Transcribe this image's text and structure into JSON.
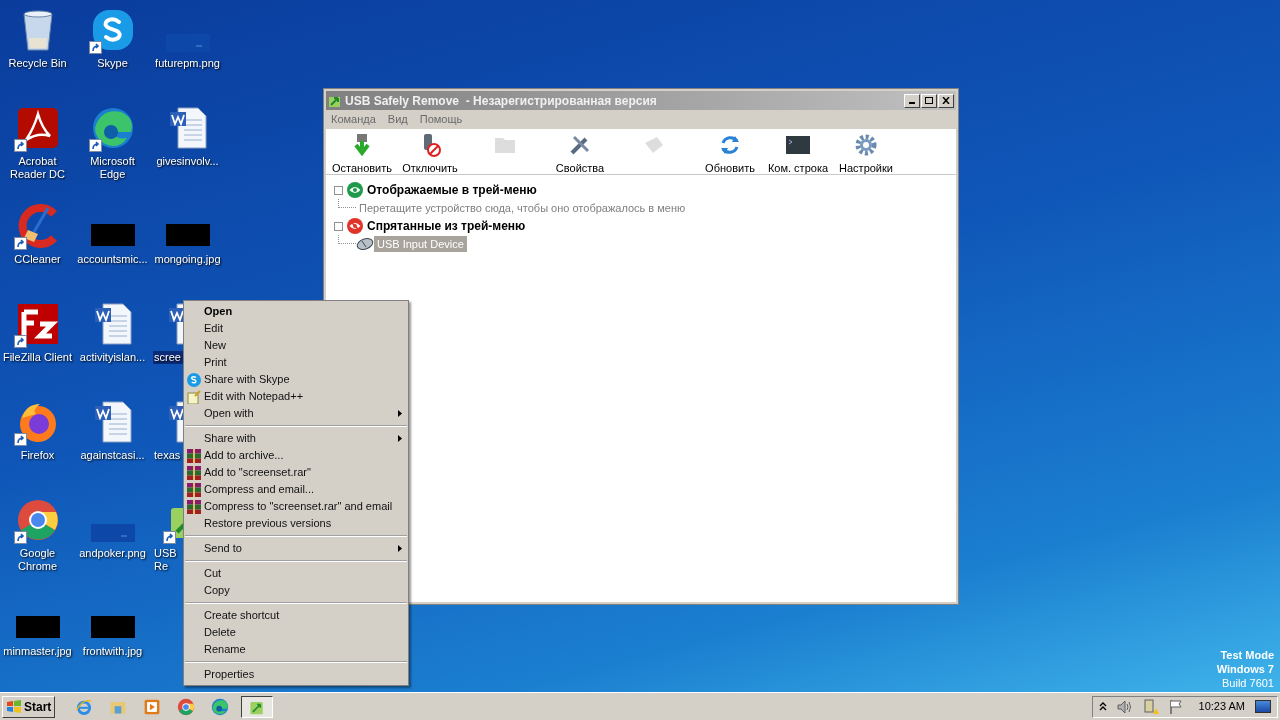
{
  "desktop": {
    "icons": [
      {
        "label": "Recycle Bin",
        "kind": "recycle",
        "shortcut": false,
        "selected": false,
        "covered": false
      },
      {
        "label": "Skype",
        "kind": "skype",
        "shortcut": true,
        "selected": false,
        "covered": false
      },
      {
        "label": "futurepm.png",
        "kind": "thumbblue",
        "shortcut": false,
        "selected": false,
        "covered": false
      },
      {
        "label": "Acrobat Reader DC",
        "kind": "pdf",
        "shortcut": true,
        "selected": false,
        "covered": false
      },
      {
        "label": "Microsoft Edge",
        "kind": "edge",
        "shortcut": true,
        "selected": false,
        "covered": false
      },
      {
        "label": "givesinvolv...",
        "kind": "word",
        "shortcut": false,
        "selected": false,
        "covered": false
      },
      {
        "label": "CCleaner",
        "kind": "ccleaner",
        "shortcut": true,
        "selected": false,
        "covered": false
      },
      {
        "label": "accountsmic...",
        "kind": "thumbblack",
        "shortcut": false,
        "selected": false,
        "covered": false
      },
      {
        "label": "mongoing.jpg",
        "kind": "thumbblack",
        "shortcut": false,
        "selected": false,
        "covered": false
      },
      {
        "label": "FileZilla Client",
        "kind": "filezilla",
        "shortcut": true,
        "selected": false,
        "covered": false
      },
      {
        "label": "activityislan...",
        "kind": "word",
        "shortcut": false,
        "selected": false,
        "covered": false
      },
      {
        "label": "scree",
        "kind": "word",
        "shortcut": false,
        "selected": true,
        "covered": true
      },
      {
        "label": "Firefox",
        "kind": "firefox",
        "shortcut": true,
        "selected": false,
        "covered": false
      },
      {
        "label": "againstcasi...",
        "kind": "word",
        "shortcut": false,
        "selected": false,
        "covered": false
      },
      {
        "label": "texas",
        "kind": "word",
        "shortcut": false,
        "selected": false,
        "covered": true
      },
      {
        "label": "Google Chrome",
        "kind": "chrome",
        "shortcut": true,
        "selected": false,
        "covered": false
      },
      {
        "label": "andpoker.png",
        "kind": "thumbblue",
        "shortcut": false,
        "selected": false,
        "covered": false
      },
      {
        "label": "USB Re",
        "kind": "usb",
        "shortcut": true,
        "selected": false,
        "covered": true
      },
      {
        "label": "minmaster.jpg",
        "kind": "thumbblack",
        "shortcut": false,
        "selected": false,
        "covered": false
      },
      {
        "label": "frontwith.jpg",
        "kind": "thumbblack",
        "shortcut": false,
        "selected": false,
        "covered": false
      }
    ]
  },
  "window": {
    "title": "USB Safely Remove  - Незарегистрированная версия",
    "active": false,
    "menu": [
      "Команда",
      "Вид",
      "Помощь"
    ],
    "toolbar": [
      {
        "label": "Остановить",
        "kind": "stop",
        "disabled": false
      },
      {
        "label": "Отключить",
        "kind": "unplug",
        "disabled": false
      },
      {
        "kind": "folder",
        "disabled": true
      },
      {
        "label": "Свойства",
        "kind": "props",
        "disabled": false
      },
      {
        "kind": "plugs",
        "disabled": true
      },
      {
        "label": "Обновить",
        "kind": "refresh",
        "disabled": false
      },
      {
        "label": "Ком. строка",
        "kind": "console",
        "disabled": false
      },
      {
        "label": "Настройки",
        "kind": "gear",
        "disabled": false
      }
    ],
    "tree": [
      {
        "label": "Отображаемые в трей-меню",
        "kind": "shown",
        "expanded": true,
        "children": [
          {
            "label": "Перетащите устройство сюда, чтобы оно отображалось в меню",
            "kind": "hint",
            "selected": false
          }
        ]
      },
      {
        "label": "Спрятанные из трей-меню",
        "kind": "hidden",
        "expanded": true,
        "children": [
          {
            "label": "USB Input Device",
            "kind": "device",
            "selected": true
          }
        ]
      }
    ]
  },
  "context_menu": {
    "groups": [
      {
        "items": [
          {
            "label": "Open",
            "kind": "plain",
            "bold": true,
            "submenu": false
          },
          {
            "label": "Edit",
            "kind": "plain",
            "bold": false,
            "submenu": false
          },
          {
            "label": "New",
            "kind": "plain",
            "bold": false,
            "submenu": false
          },
          {
            "label": "Print",
            "kind": "plain",
            "bold": false,
            "submenu": false
          },
          {
            "label": "Share with Skype",
            "kind": "skype",
            "bold": false,
            "submenu": false
          },
          {
            "label": "Edit with Notepad++",
            "kind": "notepad",
            "bold": false,
            "submenu": false
          },
          {
            "label": "Open with",
            "kind": "plain",
            "bold": false,
            "submenu": true
          }
        ]
      },
      {
        "items": [
          {
            "label": "Share with",
            "kind": "plain",
            "bold": false,
            "submenu": true
          },
          {
            "label": "Add to archive...",
            "kind": "rar",
            "bold": false,
            "submenu": false
          },
          {
            "label": "Add to \"screenset.rar\"",
            "kind": "rar",
            "bold": false,
            "submenu": false
          },
          {
            "label": "Compress and email...",
            "kind": "rar",
            "bold": false,
            "submenu": false
          },
          {
            "label": "Compress to \"screenset.rar\" and email",
            "kind": "rar",
            "bold": false,
            "submenu": false
          },
          {
            "label": "Restore previous versions",
            "kind": "plain",
            "bold": false,
            "submenu": false
          }
        ]
      },
      {
        "items": [
          {
            "label": "Send to",
            "kind": "plain",
            "bold": false,
            "submenu": true
          }
        ]
      },
      {
        "items": [
          {
            "label": "Cut",
            "kind": "plain",
            "bold": false,
            "submenu": false
          },
          {
            "label": "Copy",
            "kind": "plain",
            "bold": false,
            "submenu": false
          }
        ]
      },
      {
        "items": [
          {
            "label": "Create shortcut",
            "kind": "plain",
            "bold": false,
            "submenu": false
          },
          {
            "label": "Delete",
            "kind": "plain",
            "bold": false,
            "submenu": false
          },
          {
            "label": "Rename",
            "kind": "plain",
            "bold": false,
            "submenu": false
          }
        ]
      },
      {
        "items": [
          {
            "label": "Properties",
            "kind": "plain",
            "bold": false,
            "submenu": false
          }
        ]
      }
    ]
  },
  "os_notice": [
    "Test Mode",
    "Windows 7",
    "Build 7601"
  ],
  "taskbar": {
    "start": "Start",
    "apps": [
      {
        "kind": "ie",
        "active": false
      },
      {
        "kind": "explorer",
        "active": false
      },
      {
        "kind": "media",
        "active": false
      },
      {
        "kind": "chrome",
        "active": false
      },
      {
        "kind": "edge",
        "active": false
      },
      {
        "kind": "usb",
        "active": true
      }
    ],
    "tray": {
      "clock": "10:23 AM"
    }
  }
}
